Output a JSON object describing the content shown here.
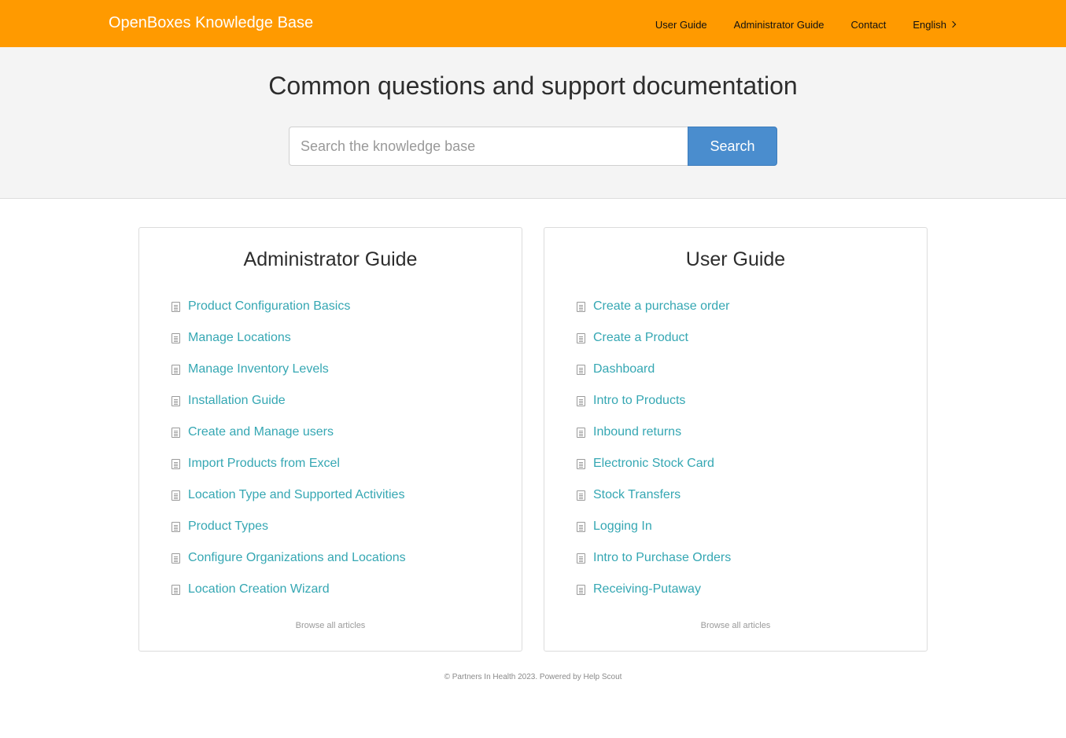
{
  "header": {
    "brand": "OpenBoxes Knowledge Base",
    "nav": [
      "User Guide",
      "Administrator Guide",
      "Contact",
      "English"
    ]
  },
  "hero": {
    "title": "Common questions and support documentation",
    "search_placeholder": "Search the knowledge base",
    "search_button": "Search"
  },
  "cards": [
    {
      "title": "Administrator Guide",
      "articles": [
        "Product Configuration Basics",
        "Manage Locations",
        "Manage Inventory Levels",
        "Installation Guide",
        "Create and Manage users",
        "Import Products from Excel",
        "Location Type and Supported Activities",
        "Product Types",
        "Configure Organizations and Locations",
        "Location Creation Wizard"
      ],
      "browse": "Browse all articles"
    },
    {
      "title": "User Guide",
      "articles": [
        "Create a purchase order",
        "Create a Product",
        "Dashboard",
        "Intro to Products",
        "Inbound returns",
        "Electronic Stock Card",
        "Stock Transfers",
        "Logging In",
        "Intro to Purchase Orders",
        "Receiving-Putaway"
      ],
      "browse": "Browse all articles"
    }
  ],
  "footer": "© Partners In Health 2023. Powered by Help Scout",
  "colors": {
    "header_bg": "#ff9a00",
    "link": "#35a7b3",
    "search_button": "#4a8dce"
  }
}
